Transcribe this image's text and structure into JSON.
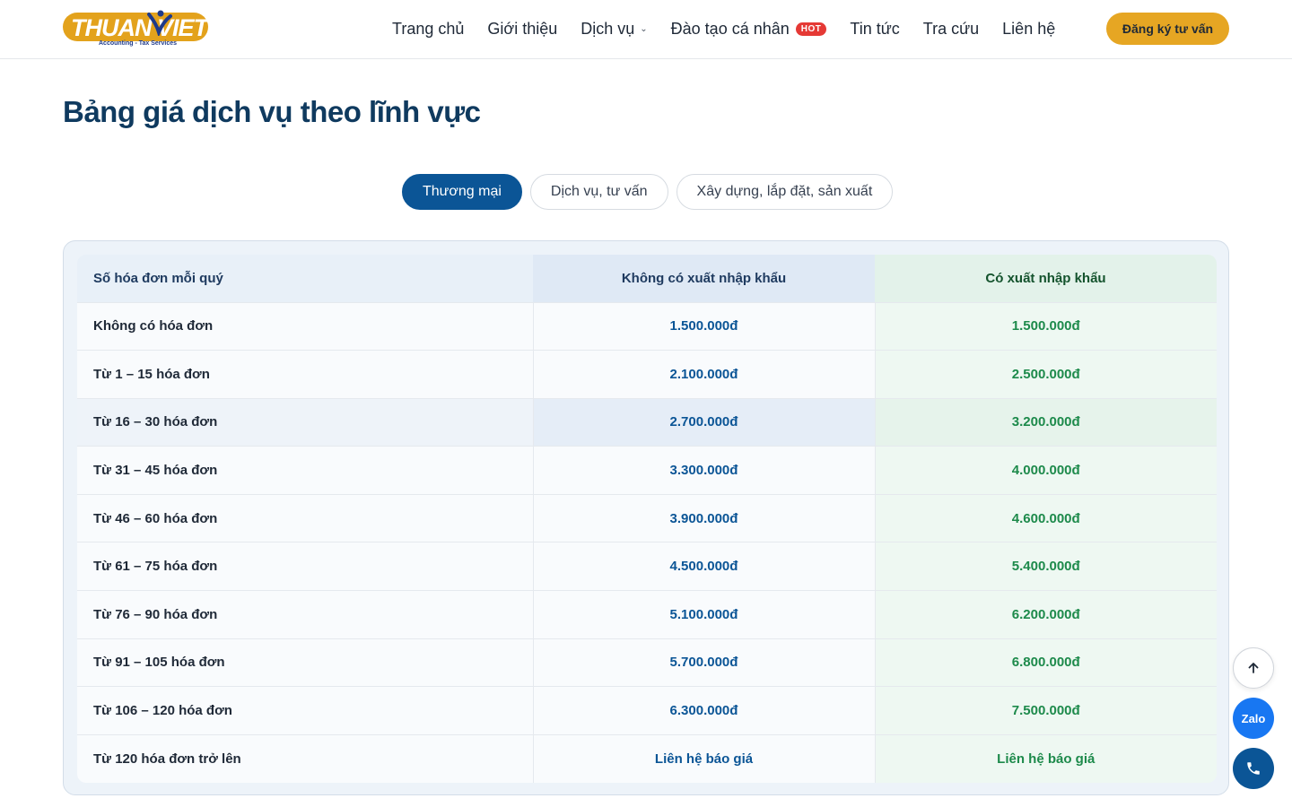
{
  "brand": {
    "logo_text": "THUAN VIET",
    "logo_tagline": "Accounting - Tax Services",
    "accent": "#e6a623",
    "primary": "#0b5596",
    "green": "#1d8a4b"
  },
  "nav": {
    "items": [
      {
        "label": "Trang chủ"
      },
      {
        "label": "Giới thiệu"
      },
      {
        "label": "Dịch vụ"
      },
      {
        "label": "Đào tạo cá nhân",
        "badge": "HOT"
      },
      {
        "label": "Tin tức"
      },
      {
        "label": "Tra cứu"
      },
      {
        "label": "Liên hệ"
      }
    ],
    "cta_label": "Đăng ký tư vấn"
  },
  "page": {
    "title": "Bảng giá dịch vụ theo lĩnh vực"
  },
  "tabs": [
    {
      "label": "Thương mại",
      "active": true
    },
    {
      "label": "Dịch vụ, tư vấn",
      "active": false
    },
    {
      "label": "Xây dựng, lắp đặt, sản xuất",
      "active": false
    }
  ],
  "table": {
    "headers": [
      "Số hóa đơn mỗi quý",
      "Không có xuất nhập khẩu",
      "Có xuất nhập khẩu"
    ],
    "rows": [
      [
        "Không có hóa đơn",
        "1.500.000đ",
        "1.500.000đ"
      ],
      [
        "Từ 1 – 15 hóa đơn",
        "2.100.000đ",
        "2.500.000đ"
      ],
      [
        "Từ 16 – 30 hóa đơn",
        "2.700.000đ",
        "3.200.000đ"
      ],
      [
        "Từ 31 – 45 hóa đơn",
        "3.300.000đ",
        "4.000.000đ"
      ],
      [
        "Từ 46 – 60 hóa đơn",
        "3.900.000đ",
        "4.600.000đ"
      ],
      [
        "Từ 61 – 75 hóa đơn",
        "4.500.000đ",
        "5.400.000đ"
      ],
      [
        "Từ 76 – 90 hóa đơn",
        "5.100.000đ",
        "6.200.000đ"
      ],
      [
        "Từ 91 – 105 hóa đơn",
        "5.700.000đ",
        "6.800.000đ"
      ],
      [
        "Từ 106 – 120 hóa đơn",
        "6.300.000đ",
        "7.500.000đ"
      ],
      [
        "Từ 120 hóa đơn trở lên",
        "Liên hệ báo giá",
        "Liên hệ báo giá"
      ]
    ],
    "highlighted_row": 2
  },
  "floating": {
    "scroll_top_icon": "arrow-up-icon",
    "zalo_label": "Zalo",
    "phone_icon": "phone-icon"
  }
}
